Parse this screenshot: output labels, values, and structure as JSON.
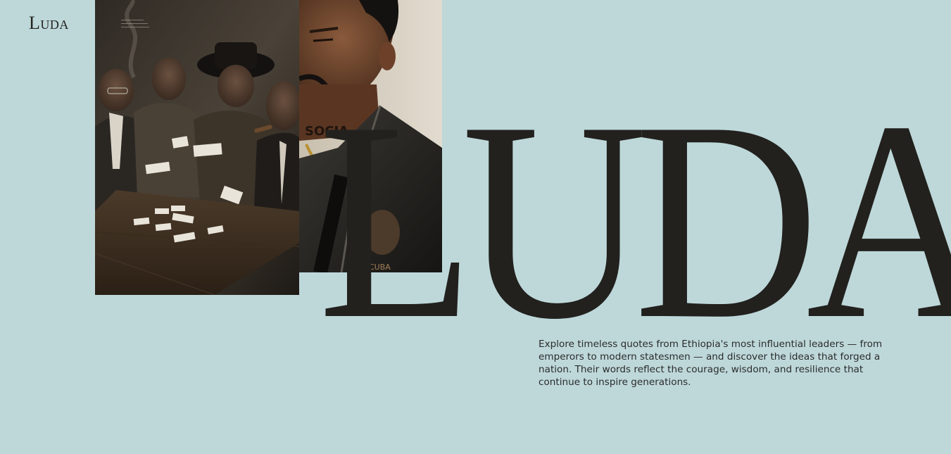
{
  "header": {
    "logo": "Luda",
    "menu_icon": "hamburger-menu-icon"
  },
  "hero": {
    "headline": "LUDA",
    "intro": "Explore timeless quotes from Ethiopia's most influential leaders — from emperors to modern statesmen — and discover the ideas that forged a nation. Their words reflect the courage, wisdom, and resilience that continue to inspire generations."
  },
  "photos": [
    {
      "name": "card-players-photo"
    },
    {
      "name": "leather-jacket-portrait-photo",
      "tattoo_text": "CUBA"
    }
  ],
  "colors": {
    "background": "#bed8da",
    "text": "#22211e"
  }
}
